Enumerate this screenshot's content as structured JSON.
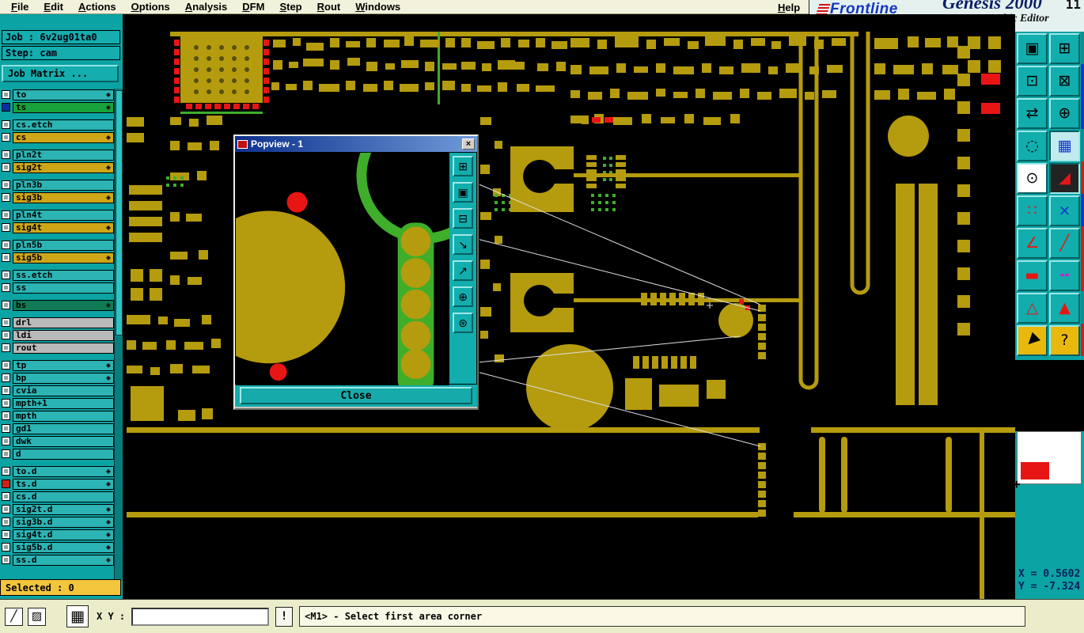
{
  "colors": {
    "teal": "#0ba3a3",
    "panel": "#12adad",
    "gold": "#b59b0e",
    "pcb-green": "#3fae2a",
    "red": "#e81515",
    "cream": "#f2f2dc",
    "statusbar-bg": "#ebecca",
    "selected-yellow": "#f2c53d",
    "navy": "#03215c"
  },
  "menubar": {
    "items": [
      {
        "label": "File",
        "name": "menu-file"
      },
      {
        "label": "Edit",
        "name": "menu-edit"
      },
      {
        "label": "Actions",
        "name": "menu-actions"
      },
      {
        "label": "Options",
        "name": "menu-options"
      },
      {
        "label": "Analysis",
        "name": "menu-analysis"
      },
      {
        "label": "DFM",
        "name": "menu-dfm"
      },
      {
        "label": "Step",
        "name": "menu-step"
      },
      {
        "label": "Rout",
        "name": "menu-rout"
      },
      {
        "label": "Windows",
        "name": "menu-windows"
      }
    ],
    "help": "Help"
  },
  "brand": {
    "logo_text": "Frontline",
    "product": "Genesis 2000",
    "subtitle": "Graphic Editor",
    "version_fragment": "11"
  },
  "sidebar": {
    "job_label": "Job : 6v2ug01ta0",
    "step_label": "Step: cam",
    "job_matrix_button": "Job Matrix ...",
    "selected_label": "Selected : 0",
    "diamond_glyph": "◆",
    "layers": [
      {
        "label": "to",
        "cls": "lt mark"
      },
      {
        "label": "ts",
        "cls": "green mark cb-blue gap"
      },
      {
        "label": "cs.etch",
        "cls": "lt"
      },
      {
        "label": "cs",
        "cls": "gold mark gap"
      },
      {
        "label": "pln2t",
        "cls": "lt"
      },
      {
        "label": "sig2t",
        "cls": "gold mark gap"
      },
      {
        "label": "pln3b",
        "cls": "lt"
      },
      {
        "label": "sig3b",
        "cls": "gold mark gap"
      },
      {
        "label": "pln4t",
        "cls": "lt"
      },
      {
        "label": "sig4t",
        "cls": "gold mark gap"
      },
      {
        "label": "pln5b",
        "cls": "lt"
      },
      {
        "label": "sig5b",
        "cls": "gold mark gap"
      },
      {
        "label": "ss.etch",
        "cls": "lt"
      },
      {
        "label": "ss",
        "cls": "lt gap"
      },
      {
        "label": "bs",
        "cls": "dgreen mark gap"
      },
      {
        "label": "drl",
        "cls": "gray"
      },
      {
        "label": "ldi",
        "cls": "gray"
      },
      {
        "label": "rout",
        "cls": "gray gap"
      },
      {
        "label": "tp",
        "cls": "lt mark"
      },
      {
        "label": "bp",
        "cls": "lt mark"
      },
      {
        "label": "cvia",
        "cls": "lt"
      },
      {
        "label": "mpth+1",
        "cls": "lt"
      },
      {
        "label": "mpth",
        "cls": "lt"
      },
      {
        "label": "gd1",
        "cls": "lt"
      },
      {
        "label": "dwk",
        "cls": "lt"
      },
      {
        "label": "d",
        "cls": "lt gap"
      },
      {
        "label": "to.d",
        "cls": "lt mark"
      },
      {
        "label": "ts.d",
        "cls": "lt mark cb-red"
      },
      {
        "label": "cs.d",
        "cls": "lt"
      },
      {
        "label": "sig2t.d",
        "cls": "lt mark"
      },
      {
        "label": "sig3b.d",
        "cls": "lt mark"
      },
      {
        "label": "sig4t.d",
        "cls": "lt mark"
      },
      {
        "label": "sig5b.d",
        "cls": "lt mark"
      },
      {
        "label": "ss.d",
        "cls": "lt mark"
      }
    ]
  },
  "popview": {
    "title": "Popview - 1",
    "close_x": "×",
    "close_button": "Close",
    "tools": [
      {
        "name": "popview-window-button",
        "glyph": "⊞"
      },
      {
        "name": "popview-screen-button",
        "glyph": "▣"
      },
      {
        "name": "popview-monitor-button",
        "glyph": "⊟"
      },
      {
        "name": "popview-zoom-in-button",
        "glyph": "↘"
      },
      {
        "name": "popview-zoom-out-button",
        "glyph": "↗"
      },
      {
        "name": "popview-pan-button",
        "glyph": "⊕"
      },
      {
        "name": "popview-center-button",
        "glyph": "⊛"
      }
    ]
  },
  "right_toolbar": {
    "buttons": [
      {
        "name": "screen-redraw-button",
        "glyph": "▣",
        "cls": "c-black"
      },
      {
        "name": "screen-layers-button",
        "glyph": "⊞",
        "cls": "c-black"
      },
      {
        "name": "zoom-window-button",
        "glyph": "⊡",
        "cls": "c-black"
      },
      {
        "name": "zoom-out-button",
        "glyph": "⊠",
        "cls": "c-black"
      },
      {
        "name": "view-exchange-button",
        "glyph": "⇄",
        "cls": "c-black"
      },
      {
        "name": "zoom-center-button",
        "glyph": "⊕",
        "cls": "c-black"
      },
      {
        "name": "previous-view-button",
        "glyph": "◌",
        "cls": "c-black"
      },
      {
        "name": "grid-toggle-button",
        "glyph": "▦",
        "cls": "c-blue pressed"
      },
      {
        "name": "origin-select-button",
        "glyph": "⊙",
        "cls": "c-black bg-white"
      },
      {
        "name": "negative-layer-button",
        "glyph": "◢",
        "cls": "c-red bg-dark"
      },
      {
        "name": "highlight-net-button",
        "glyph": "∷",
        "cls": "c-red"
      },
      {
        "name": "clear-highlight-button",
        "glyph": "×",
        "cls": "c-blue"
      },
      {
        "name": "measure-angle-button",
        "glyph": "∠",
        "cls": "c-red"
      },
      {
        "name": "draw-line-button",
        "glyph": "╱",
        "cls": "c-red"
      },
      {
        "name": "add-pad-button",
        "glyph": "▬",
        "cls": "c-red"
      },
      {
        "name": "dashed-line-button",
        "glyph": "╍",
        "cls": "c-magenta"
      },
      {
        "name": "triangle-outline-button",
        "glyph": "△",
        "cls": "c-red"
      },
      {
        "name": "triangle-marker-button",
        "glyph": "▲",
        "cls": "c-red"
      },
      {
        "name": "pointer-select-button",
        "glyph": "▲",
        "cls": "c-black bg-gold rot"
      },
      {
        "name": "pointer-query-button",
        "glyph": "?",
        "cls": "c-black bg-gold"
      }
    ]
  },
  "coords": {
    "x_label": "X = 0.5602",
    "y_label": "Y = -7.324"
  },
  "statusbar": {
    "xy_label": "X Y :",
    "xy_value": "",
    "alert_button": "!",
    "message": "<M1> - Select first area corner",
    "tools": [
      {
        "name": "diagonal-line-button",
        "glyph": "╱"
      },
      {
        "name": "diagonal-grid-button",
        "glyph": "▨"
      },
      {
        "name": "grid-table-button",
        "glyph": "▦"
      }
    ]
  }
}
